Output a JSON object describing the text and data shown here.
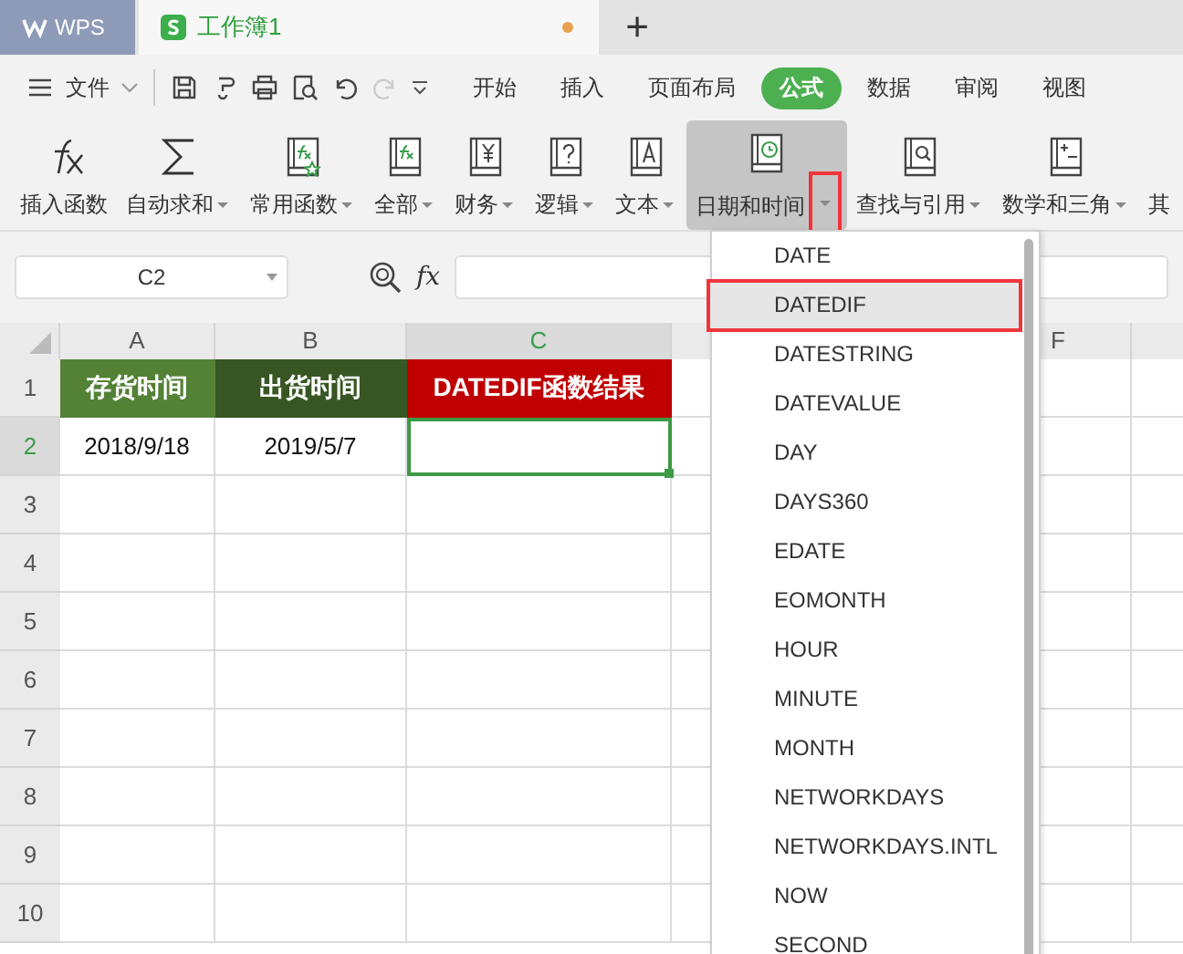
{
  "app_tabs": [
    {
      "kind": "brand",
      "label": "WPS"
    },
    {
      "kind": "doc",
      "label": "工作簿1",
      "selected": true,
      "unsaved": true
    }
  ],
  "new_tab": "+",
  "menu": {
    "file": "文件",
    "tabs": [
      {
        "label": "开始",
        "selected": false
      },
      {
        "label": "插入",
        "selected": false
      },
      {
        "label": "页面布局",
        "selected": false
      },
      {
        "label": "公式",
        "selected": true
      },
      {
        "label": "数据",
        "selected": false
      },
      {
        "label": "审阅",
        "selected": false
      },
      {
        "label": "视图",
        "selected": false
      }
    ]
  },
  "ribbon": [
    {
      "kind": "fx",
      "label": "插入函数",
      "has_menu": false,
      "selected": false
    },
    {
      "kind": "sum",
      "label": "自动求和",
      "has_menu": true,
      "selected": false
    },
    {
      "kind": "star",
      "label": "常用函数",
      "has_menu": true,
      "selected": false
    },
    {
      "kind": "book_fx",
      "label": "全部",
      "has_menu": true,
      "selected": false
    },
    {
      "kind": "yen",
      "label": "财务",
      "has_menu": true,
      "selected": false
    },
    {
      "kind": "question",
      "label": "逻辑",
      "has_menu": true,
      "selected": false
    },
    {
      "kind": "text",
      "label": "文本",
      "has_menu": true,
      "selected": false
    },
    {
      "kind": "clock",
      "label": "日期和时间",
      "has_menu": true,
      "selected": true,
      "marked": true
    },
    {
      "kind": "search",
      "label": "查找与引用",
      "has_menu": true,
      "selected": false
    },
    {
      "kind": "math",
      "label": "数学和三角",
      "has_menu": true,
      "selected": false
    },
    {
      "kind": "none",
      "label": "其",
      "has_menu": false,
      "selected": false
    }
  ],
  "formula_bar": {
    "name_box": "C2",
    "fx": "fx"
  },
  "columns": [
    {
      "label": "A",
      "selected": false
    },
    {
      "label": "B",
      "selected": false
    },
    {
      "label": "C",
      "selected": true
    },
    {
      "label": "F",
      "selected": false
    }
  ],
  "rows": [
    {
      "label": "1",
      "selected": false,
      "cells": [
        {
          "value": "存货时间",
          "color": "#538135"
        },
        {
          "value": "出货时间",
          "color": "#375623"
        },
        {
          "value": "DATEDIF函数结果",
          "color": "#c00000"
        }
      ]
    },
    {
      "label": "2",
      "selected": true,
      "cells": [
        {
          "value": "2018/9/18"
        },
        {
          "value": "2019/5/7"
        },
        {
          "active": true
        }
      ]
    },
    {
      "label": "3",
      "selected": false,
      "cells": []
    },
    {
      "label": "4",
      "selected": false,
      "cells": []
    },
    {
      "label": "5",
      "selected": false,
      "cells": []
    },
    {
      "label": "6",
      "selected": false,
      "cells": []
    },
    {
      "label": "7",
      "selected": false,
      "cells": []
    },
    {
      "label": "8",
      "selected": false,
      "cells": []
    },
    {
      "label": "9",
      "selected": false,
      "cells": []
    },
    {
      "label": "10",
      "selected": false,
      "cells": []
    }
  ],
  "dropdown": [
    {
      "label": "DATE",
      "selected": false
    },
    {
      "label": "DATEDIF",
      "selected": true,
      "marked": true
    },
    {
      "label": "DATESTRING",
      "selected": false
    },
    {
      "label": "DATEVALUE",
      "selected": false
    },
    {
      "label": "DAY",
      "selected": false
    },
    {
      "label": "DAYS360",
      "selected": false
    },
    {
      "label": "EDATE",
      "selected": false
    },
    {
      "label": "EOMONTH",
      "selected": false
    },
    {
      "label": "HOUR",
      "selected": false
    },
    {
      "label": "MINUTE",
      "selected": false
    },
    {
      "label": "MONTH",
      "selected": false
    },
    {
      "label": "NETWORKDAYS",
      "selected": false
    },
    {
      "label": "NETWORKDAYS.INTL",
      "selected": false
    },
    {
      "label": "NOW",
      "selected": false
    },
    {
      "label": "SECOND",
      "selected": false
    }
  ]
}
